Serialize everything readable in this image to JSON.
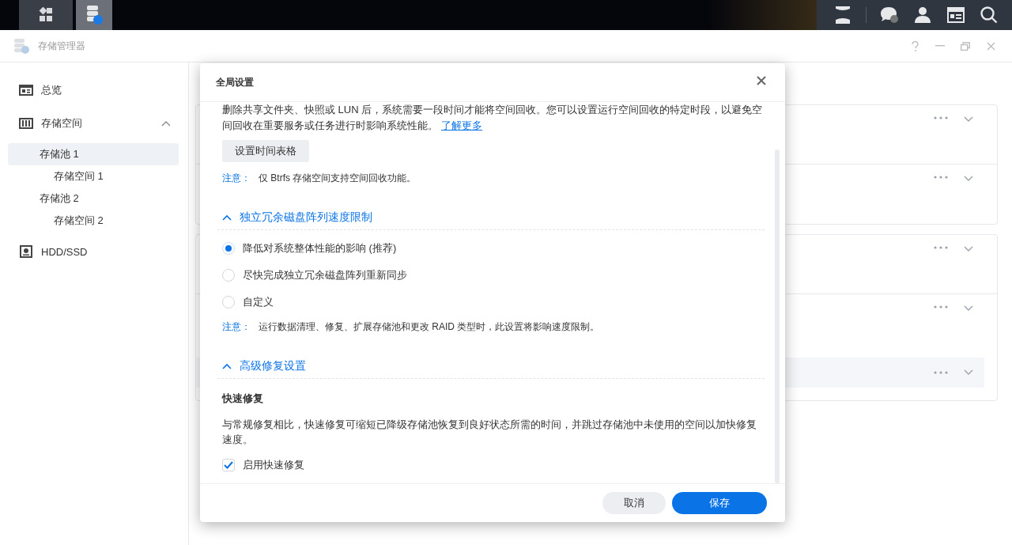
{
  "taskbar": {
    "apps": [
      {
        "kind": "main-menu",
        "selected": false
      },
      {
        "kind": "storage-manager",
        "selected": true
      }
    ],
    "tray": [
      {
        "kind": "widgets"
      },
      {
        "kind": "chat"
      },
      {
        "kind": "user"
      },
      {
        "kind": "panel"
      },
      {
        "kind": "search"
      }
    ]
  },
  "window": {
    "title": "存储管理器"
  },
  "sidebar": {
    "items": [
      {
        "label": "总览",
        "kind": "overview",
        "selected": false
      },
      {
        "label": "存储空间",
        "kind": "storage",
        "selected": false,
        "expanded": true,
        "children": [
          {
            "label": "存储池 1",
            "selected": true,
            "children": [
              {
                "label": "存储空间 1",
                "selected": false
              }
            ]
          },
          {
            "label": "存储池 2",
            "selected": false,
            "children": [
              {
                "label": "存储空间 2",
                "selected": false
              }
            ]
          }
        ]
      },
      {
        "label": "HDD/SSD",
        "kind": "disk",
        "selected": false
      }
    ]
  },
  "cards": [
    {
      "rows": [
        {
          "kind": "row"
        },
        {
          "kind": "row"
        }
      ]
    },
    {
      "rows": [
        {
          "kind": "row"
        },
        {
          "kind": "row"
        },
        {
          "kind": "subrow"
        }
      ]
    }
  ],
  "dialog": {
    "title": "全局设置",
    "intro": {
      "text": "删除共享文件夹、快照或 LUN 后，系统需要一段时间才能将空间回收。您可以设置运行空间回收的特定时段，以避免空间回收在重要服务或任务进行时影响系统性能。",
      "link": "了解更多"
    },
    "schedule_button": "设置时间表格",
    "note": {
      "label": "注意：",
      "text": "仅 Btrfs 存储空间支持空间回收功能。"
    },
    "sections": [
      {
        "title": "独立冗余磁盘阵列速度限制",
        "expanded": true,
        "options": [
          {
            "label": "降低对系统整体性能的影响 (推荐)",
            "selected": true
          },
          {
            "label": "尽快完成独立冗余磁盘阵列重新同步",
            "selected": false
          },
          {
            "label": "自定义",
            "selected": false
          }
        ],
        "note": {
          "label": "注意：",
          "text": "运行数据清理、修复、扩展存储池和更改 RAID 类型时，此设置将影响速度限制。"
        }
      },
      {
        "title": "高级修复设置",
        "expanded": true,
        "subtitle": "快速修复",
        "description": "与常规修复相比，快速修复可缩短已降级存储池恢复到良好状态所需的时间，并跳过存储池中未使用的空间以加快修复速度。",
        "checkbox": {
          "label": "启用快速修复",
          "checked": true
        }
      }
    ],
    "buttons": [
      {
        "label": "取消",
        "kind": "secondary"
      },
      {
        "label": "保存",
        "kind": "primary"
      }
    ]
  }
}
